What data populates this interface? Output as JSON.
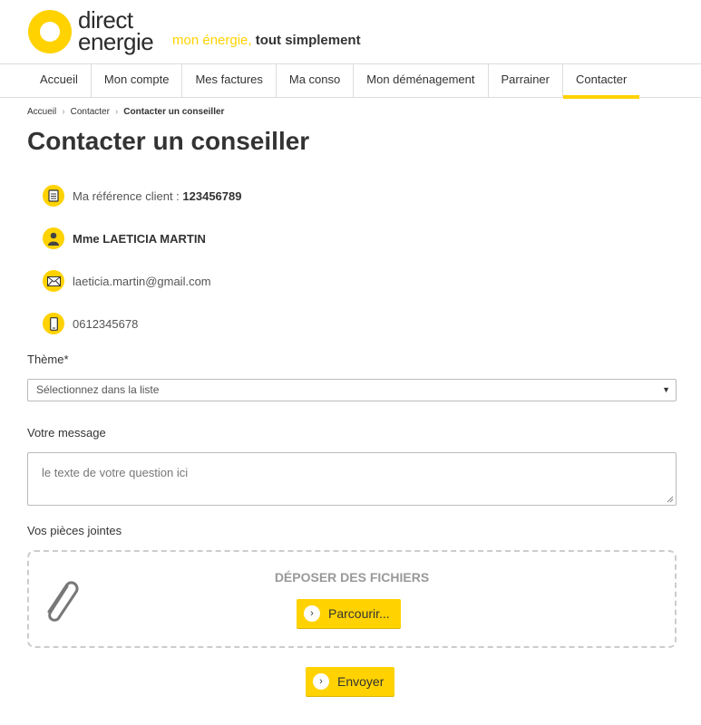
{
  "brand": {
    "logo_line1": "direct",
    "logo_line2": "energie",
    "tagline_yellow": "mon énergie,",
    "tagline_rest": "tout simplement",
    "accent_color": "#ffd200"
  },
  "nav": {
    "items": [
      {
        "label": "Accueil"
      },
      {
        "label": "Mon compte"
      },
      {
        "label": "Mes factures"
      },
      {
        "label": "Ma conso"
      },
      {
        "label": "Mon déménagement"
      },
      {
        "label": "Parrainer"
      },
      {
        "label": "Contacter"
      }
    ],
    "active": "Contacter"
  },
  "breadcrumb": [
    "Accueil",
    "Contacter",
    "Contacter un conseiller"
  ],
  "page_title": "Contacter un conseiller",
  "info": {
    "reference_label": "Ma référence client :",
    "reference_value": "123456789",
    "name": "Mme LAETICIA MARTIN",
    "email": "laeticia.martin@gmail.com",
    "phone": "0612345678"
  },
  "form": {
    "theme_label": "Thème*",
    "theme_selected": "Sélectionnez dans la liste",
    "message_label": "Votre message",
    "message_placeholder": "le texte de votre question ici",
    "attachments_label": "Vos pièces jointes",
    "dropzone_title": "DÉPOSER DES FICHIERS",
    "browse_button": "Parcourir...",
    "submit_button": "Envoyer"
  },
  "icons": [
    "document-icon",
    "user-icon",
    "envelope-icon",
    "phone-icon",
    "paperclip-icon",
    "chevron-right-icon",
    "caret-down-icon"
  ]
}
